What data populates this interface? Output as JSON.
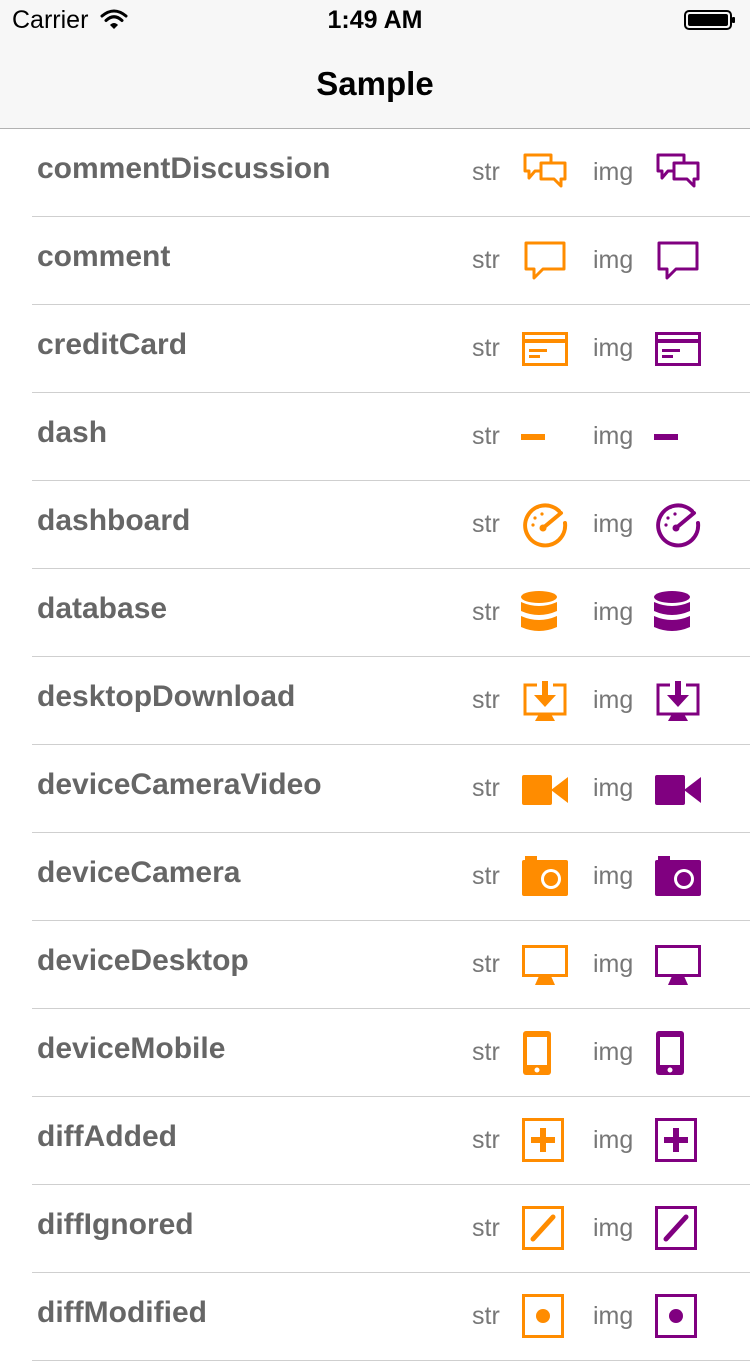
{
  "status_bar": {
    "carrier": "Carrier",
    "time": "1:49 AM"
  },
  "nav": {
    "title": "Sample"
  },
  "labels": {
    "str": "str",
    "img": "img"
  },
  "colors": {
    "str": "#ff8c00",
    "img": "#800080"
  },
  "rows": [
    {
      "name": "commentDiscussion",
      "icon": "comment-discussion-icon"
    },
    {
      "name": "comment",
      "icon": "comment-icon"
    },
    {
      "name": "creditCard",
      "icon": "credit-card-icon"
    },
    {
      "name": "dash",
      "icon": "dash-icon"
    },
    {
      "name": "dashboard",
      "icon": "dashboard-icon"
    },
    {
      "name": "database",
      "icon": "database-icon"
    },
    {
      "name": "desktopDownload",
      "icon": "desktop-download-icon"
    },
    {
      "name": "deviceCameraVideo",
      "icon": "device-camera-video-icon"
    },
    {
      "name": "deviceCamera",
      "icon": "device-camera-icon"
    },
    {
      "name": "deviceDesktop",
      "icon": "device-desktop-icon"
    },
    {
      "name": "deviceMobile",
      "icon": "device-mobile-icon"
    },
    {
      "name": "diffAdded",
      "icon": "diff-added-icon"
    },
    {
      "name": "diffIgnored",
      "icon": "diff-ignored-icon"
    },
    {
      "name": "diffModified",
      "icon": "diff-modified-icon"
    }
  ]
}
